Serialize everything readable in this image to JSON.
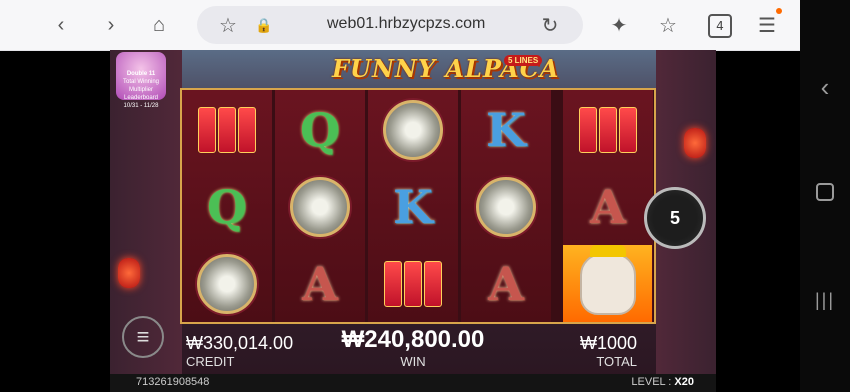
{
  "browser": {
    "url": "web01.hrbzycpzs.com",
    "tab_count": "4"
  },
  "game": {
    "title": "FUNNY ALPACA",
    "lines_badge": "5 LINES",
    "promo": {
      "line1": "Double 11",
      "line2": "Total Winning",
      "line3": "Multiplier Leaderboard",
      "dates": "10/31 - 11/28"
    },
    "reels": [
      [
        "firecrackers",
        "Q",
        "gong"
      ],
      [
        "Q",
        "gong",
        "A"
      ],
      [
        "gong",
        "K",
        "firecrackers"
      ],
      [
        "K",
        "gong",
        "A"
      ],
      [
        "firecrackers",
        "A",
        "alpaca"
      ]
    ],
    "spin_count": "5",
    "credit": {
      "value": "₩330,014.00",
      "label": "CREDIT"
    },
    "win": {
      "value": "₩240,800.00",
      "label": "WIN"
    },
    "total": {
      "value": "₩1000",
      "label": "TOTAL"
    },
    "footer": {
      "id": "713261908548",
      "level_label": "LEVEL :",
      "level_value": "X20"
    }
  },
  "icons": {
    "back": "chevron-left-icon",
    "forward": "chevron-right-icon",
    "home": "home-icon",
    "bookmark": "star-icon",
    "lock": "lock-icon",
    "reload": "reload-icon",
    "menu": "menu-icon"
  }
}
